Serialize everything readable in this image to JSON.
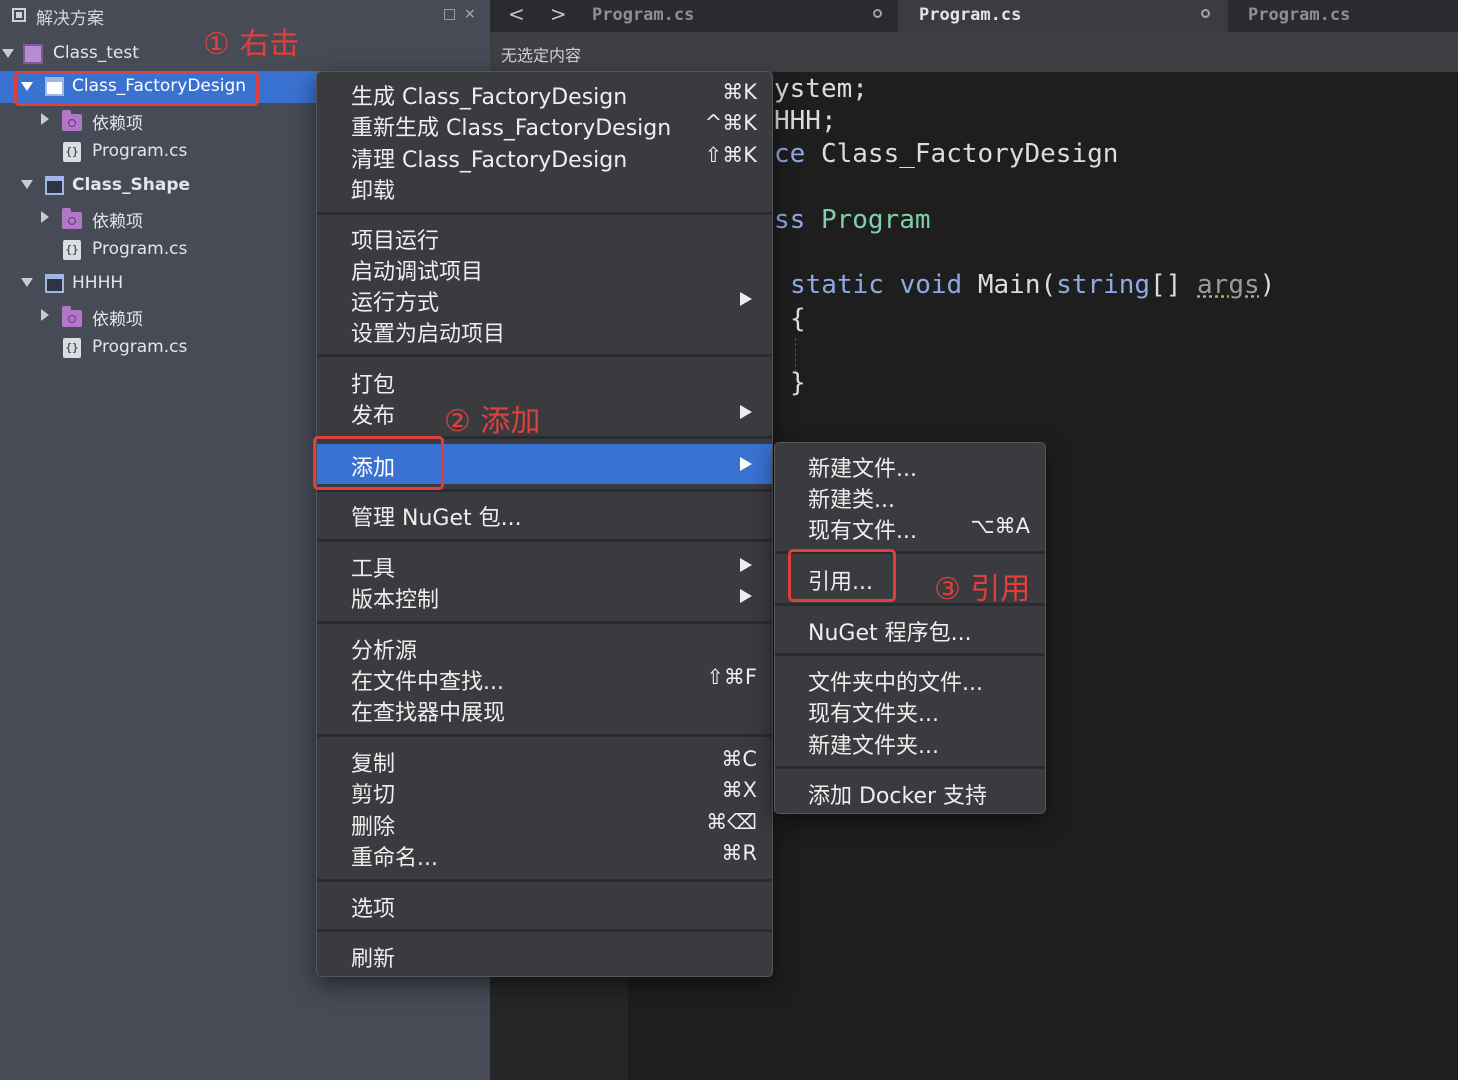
{
  "solution_pane": {
    "title": "解决方案",
    "pin_icon": "□",
    "close_icon": "×"
  },
  "tree": {
    "solution": "Class_test",
    "projects": [
      {
        "name": "Class_FactoryDesign",
        "dependencies": "依赖项",
        "file": "Program.cs"
      },
      {
        "name": "Class_Shape",
        "dependencies": "依赖项",
        "file": "Program.cs"
      },
      {
        "name": "HHHH",
        "dependencies": "依赖项",
        "file": "Program.cs"
      }
    ]
  },
  "tabs": [
    {
      "label": "Program.cs"
    },
    {
      "label": "Program.cs"
    },
    {
      "label": "Program.cs"
    }
  ],
  "nav": {
    "back": "<",
    "forward": ">"
  },
  "breadcrumb": "无选定内容",
  "code": {
    "line1": "ystem;",
    "line2": "HHH;",
    "line3_kw": "ce",
    "line3_rest": " Class_FactoryDesign",
    "line4_kw": "ss",
    "line4_type": " Program",
    "line5_kw1": "static",
    "line5_kw2": " void",
    "line5_name": " Main(",
    "line5_kw3": "string",
    "line5_rest": "[] ",
    "line5_arg": "args",
    "line5_end": ")",
    "open_brace": "{",
    "close_brace": "}"
  },
  "context_menu": {
    "build": {
      "label": "生成 Class_FactoryDesign",
      "shortcut": "⌘K"
    },
    "rebuild": {
      "label": "重新生成 Class_FactoryDesign",
      "shortcut": "^⌘K"
    },
    "clean": {
      "label": "清理 Class_FactoryDesign",
      "shortcut": "⇧⌘K"
    },
    "unload": {
      "label": "卸载"
    },
    "run": {
      "label": "项目运行"
    },
    "debug": {
      "label": "启动调试项目"
    },
    "run_with": {
      "label": "运行方式"
    },
    "set_startup": {
      "label": "设置为启动项目"
    },
    "pack": {
      "label": "打包"
    },
    "publish": {
      "label": "发布"
    },
    "add": {
      "label": "添加"
    },
    "nuget": {
      "label": "管理 NuGet 包..."
    },
    "tools": {
      "label": "工具"
    },
    "vcs": {
      "label": "版本控制"
    },
    "analyze": {
      "label": "分析源"
    },
    "find_in_files": {
      "label": "在文件中查找...",
      "shortcut": "⇧⌘F"
    },
    "reveal": {
      "label": "在查找器中展现"
    },
    "copy": {
      "label": "复制",
      "shortcut": "⌘C"
    },
    "cut": {
      "label": "剪切",
      "shortcut": "⌘X"
    },
    "delete": {
      "label": "删除",
      "shortcut": "⌘⌫"
    },
    "rename": {
      "label": "重命名...",
      "shortcut": "⌘R"
    },
    "options": {
      "label": "选项"
    },
    "refresh": {
      "label": "刷新"
    }
  },
  "add_submenu": {
    "new_file": {
      "label": "新建文件..."
    },
    "new_class": {
      "label": "新建类..."
    },
    "existing_file": {
      "label": "现有文件...",
      "shortcut": "⌥⌘A"
    },
    "reference": {
      "label": "引用..."
    },
    "nuget_package": {
      "label": "NuGet 程序包..."
    },
    "files_from_folder": {
      "label": "文件夹中的文件..."
    },
    "existing_folder": {
      "label": "现有文件夹..."
    },
    "new_folder": {
      "label": "新建文件夹..."
    },
    "docker": {
      "label": "添加 Docker 支持"
    }
  },
  "annotations": {
    "step1": "① 右击",
    "step2": "② 添加",
    "step3": "③ 引用",
    "color": "#e0403d"
  },
  "colors": {
    "selection": "#3a72d2",
    "sidebar_bg": "#474b55",
    "menu_bg": "#3a3b3f",
    "editor_bg": "#1e1e1e"
  }
}
